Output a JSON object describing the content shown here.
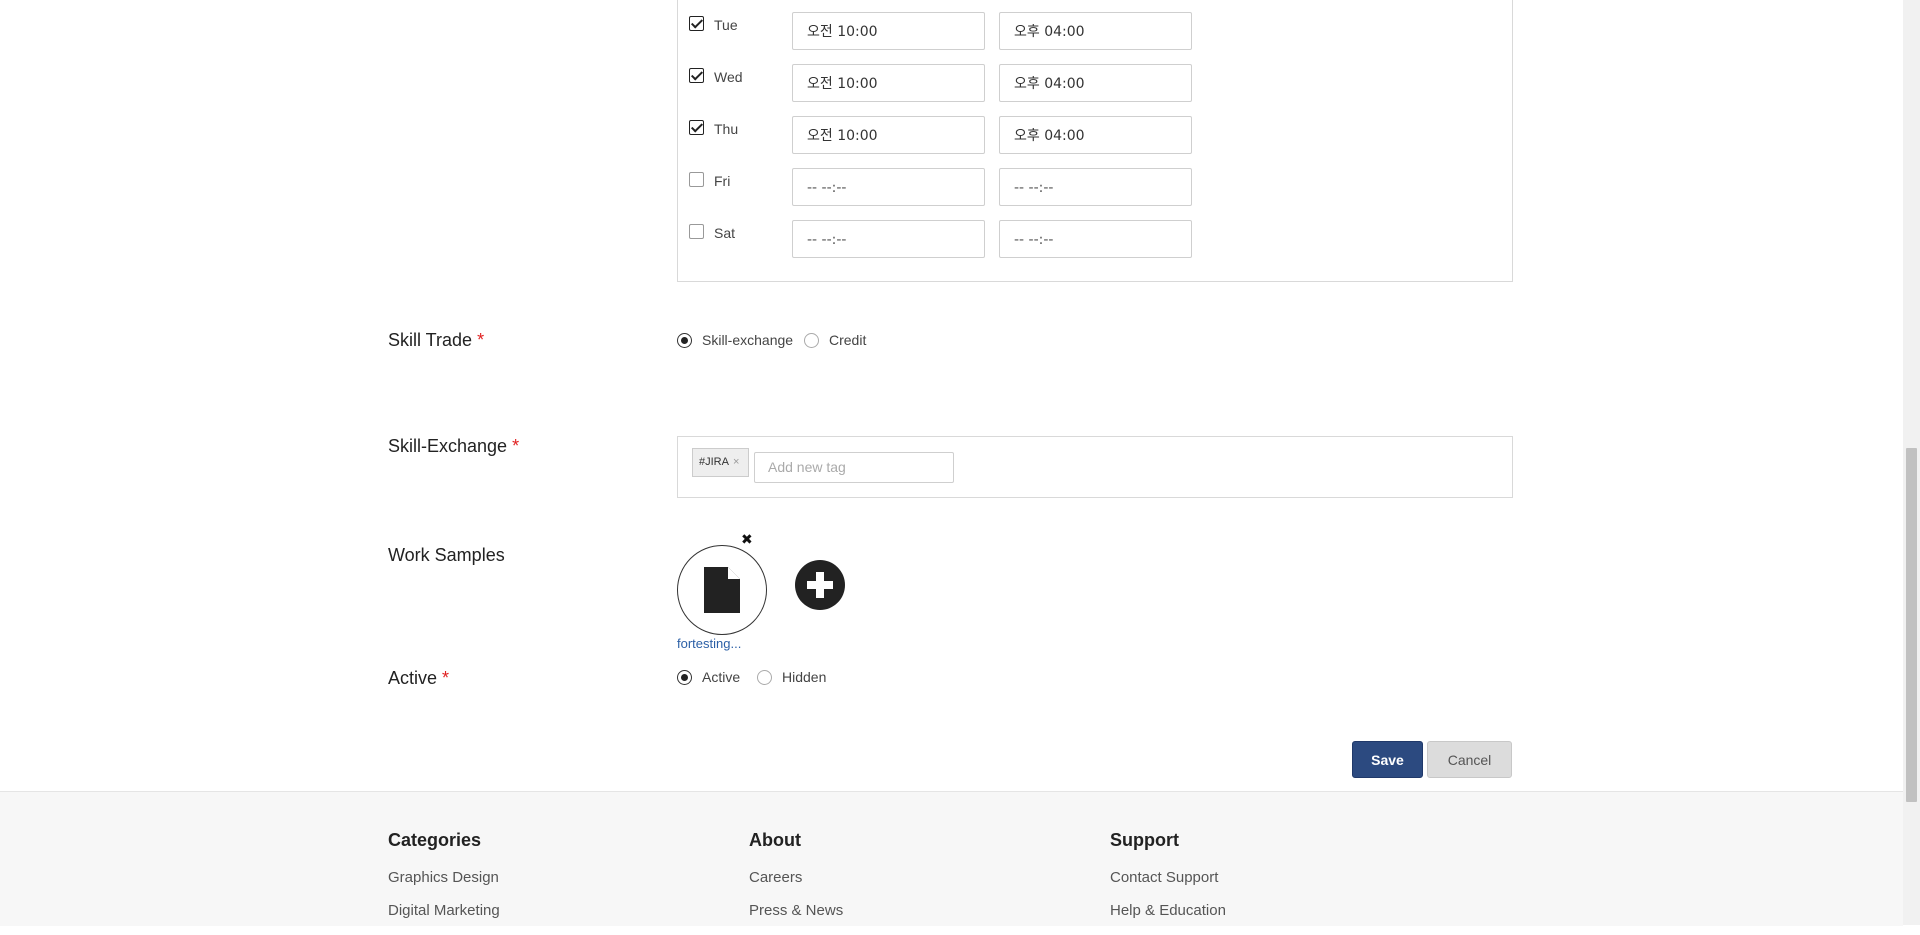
{
  "schedule": {
    "days": [
      {
        "label": "Tue",
        "checked": true,
        "start": "오전 10:00",
        "end": "오후 04:00"
      },
      {
        "label": "Wed",
        "checked": true,
        "start": "오전 10:00",
        "end": "오후 04:00"
      },
      {
        "label": "Thu",
        "checked": true,
        "start": "오전 10:00",
        "end": "오후 04:00"
      },
      {
        "label": "Fri",
        "checked": false,
        "start": "-- --:--",
        "end": "-- --:--"
      },
      {
        "label": "Sat",
        "checked": false,
        "start": "-- --:--",
        "end": "-- --:--"
      }
    ]
  },
  "skill_trade": {
    "label": "Skill Trade",
    "required_mark": "*",
    "options": [
      "Skill-exchange",
      "Credit"
    ],
    "selected": "Skill-exchange"
  },
  "skill_exchange": {
    "label": "Skill-Exchange",
    "required_mark": "*",
    "tags": [
      "#JIRA"
    ],
    "tag_remove": "×",
    "placeholder": "Add new tag"
  },
  "work_samples": {
    "label": "Work Samples",
    "remove_glyph": "✖",
    "files": [
      "fortesting..."
    ]
  },
  "active": {
    "label": "Active",
    "required_mark": "*",
    "options": [
      "Active",
      "Hidden"
    ],
    "selected": "Active"
  },
  "actions": {
    "save": "Save",
    "cancel": "Cancel"
  },
  "footer": {
    "columns": [
      {
        "title": "Categories",
        "links": [
          "Graphics Design",
          "Digital Marketing"
        ]
      },
      {
        "title": "About",
        "links": [
          "Careers",
          "Press & News"
        ]
      },
      {
        "title": "Support",
        "links": [
          "Contact Support",
          "Help & Education"
        ]
      }
    ]
  },
  "colors": {
    "primary_button": "#2c4a80",
    "required": "#e02020",
    "link": "#2b5fa6"
  }
}
